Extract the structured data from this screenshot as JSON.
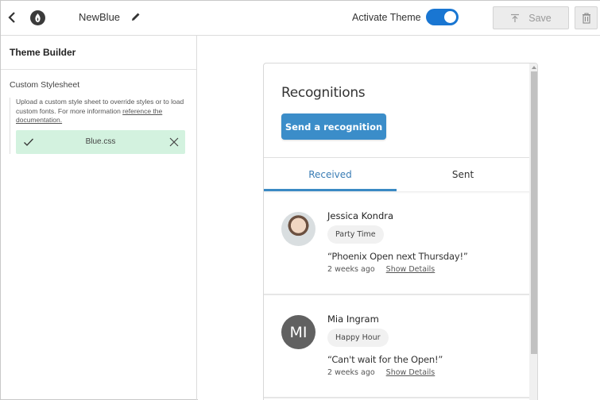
{
  "topbar": {
    "theme_name": "NewBlue",
    "activate_label": "Activate Theme",
    "activate_on": true,
    "save_label": "Save",
    "icons": {
      "back": "chevron-left-icon",
      "logo": "flame-logo-icon",
      "edit": "pencil-icon",
      "save": "upload-icon",
      "delete": "trash-icon"
    }
  },
  "sidebar": {
    "title": "Theme Builder",
    "section_label": "Custom Stylesheet",
    "description": "Upload a custom style sheet to override styles or to load custom fonts. For more information ",
    "link_text": "reference the documentation.",
    "file": {
      "name": "Blue.css",
      "status_icon": "check-icon",
      "remove_icon": "close-icon"
    }
  },
  "preview": {
    "title": "Recognitions",
    "send_button": "Send a recognition",
    "tabs": [
      {
        "label": "Received",
        "active": true
      },
      {
        "label": "Sent",
        "active": false
      }
    ],
    "items": [
      {
        "name": "Jessica Kondra",
        "avatar_type": "photo",
        "badge": "Party Time",
        "message": "“Phoenix Open next Thursday!”",
        "time": "2 weeks ago",
        "details_link": "Show Details"
      },
      {
        "name": "Mia Ingram",
        "avatar_type": "initials",
        "initials": "MI",
        "badge": "Happy Hour",
        "message": "“Can't wait for the Open!”",
        "time": "2 weeks ago",
        "details_link": "Show Details"
      }
    ]
  },
  "colors": {
    "accent": "#1976d2",
    "button_blue": "#3b8dc9",
    "tab_active": "#3a7db5",
    "file_chip_bg": "#d3f2df"
  }
}
